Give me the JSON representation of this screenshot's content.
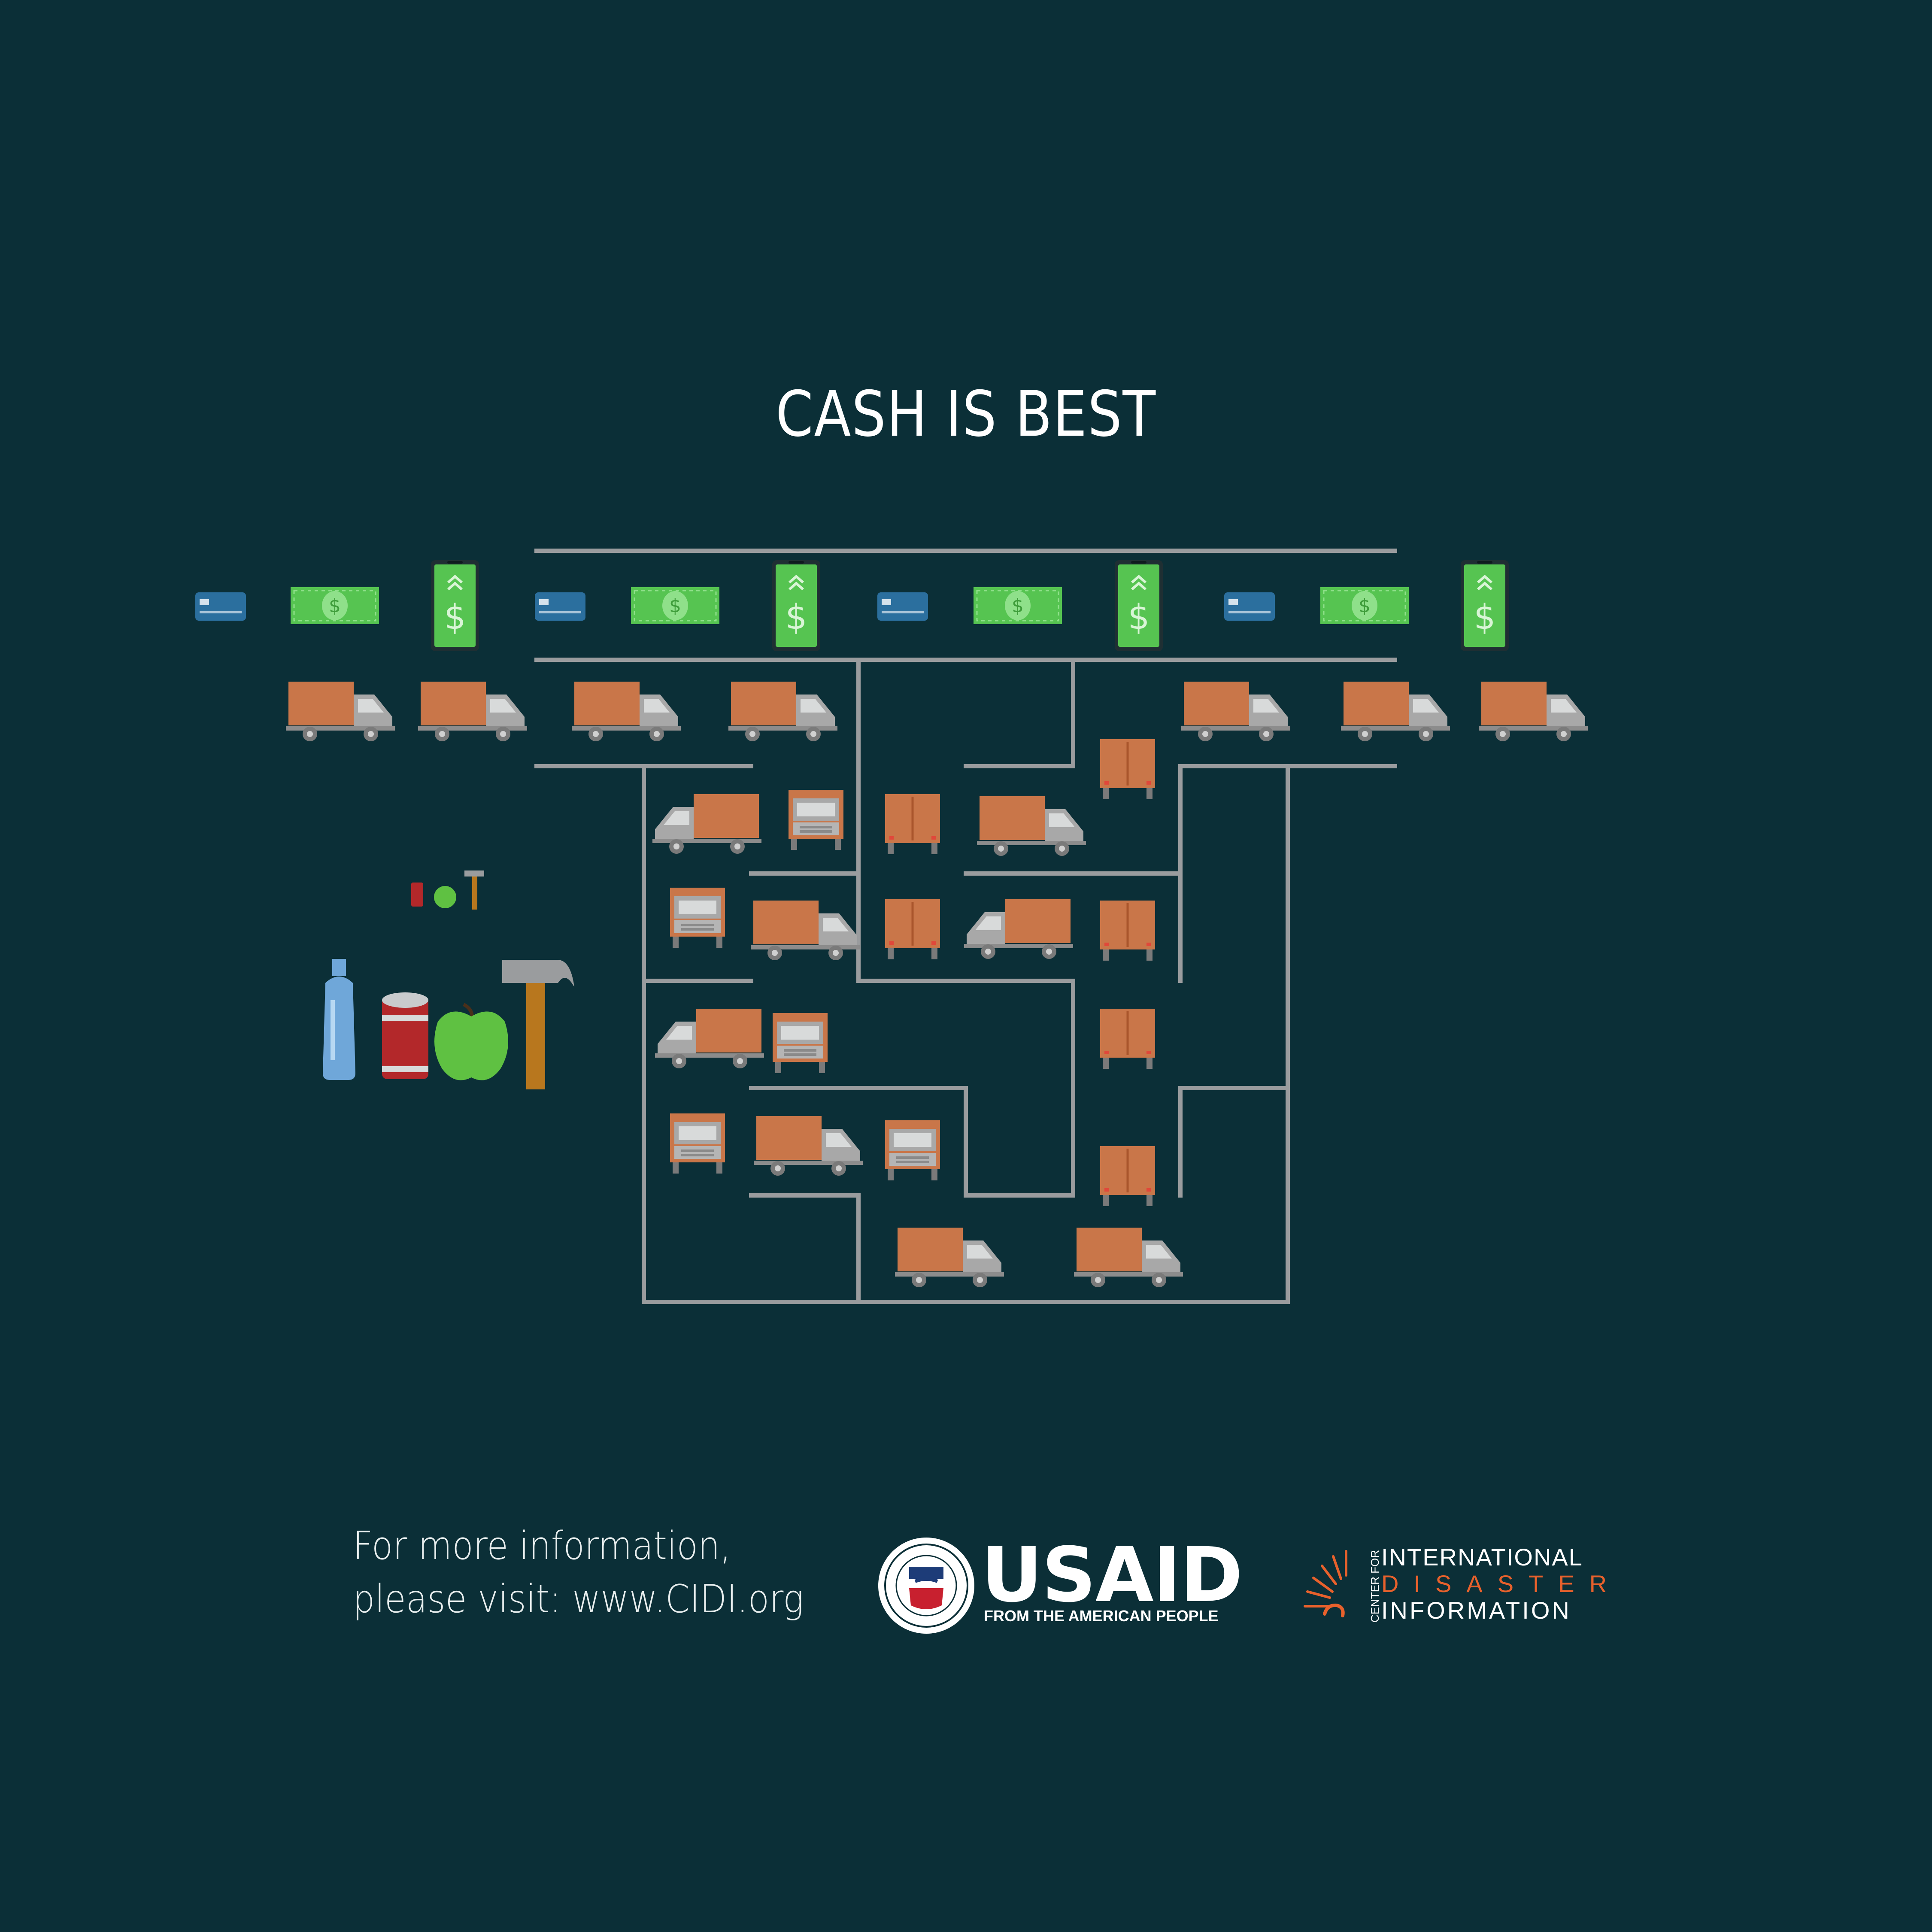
{
  "title": "CASH IS BEST",
  "colors": {
    "background": "#0b2f37",
    "maze_wall": "#9a9c9e",
    "truck_box": "#c97649",
    "truck_cab": "#a8a8a8",
    "cash_green": "#56c451",
    "card_blue": "#2b6f9e",
    "accent_orange": "#e8612c"
  },
  "footer": {
    "info_line1": "For more information,",
    "info_line2": "please visit: www.CIDI.org",
    "usaid_seal_top": "UNITED STATES AGENCY",
    "usaid_seal_bottom": "INTERNATIONAL DEVELOPMENT",
    "usaid_seal_center": "USAID",
    "usaid_word": "USAID",
    "usaid_tagline": "FROM THE AMERICAN PEOPLE",
    "cidi_vertical": "CENTER FOR",
    "cidi_line1": "INTERNATIONAL",
    "cidi_line2": "DISASTER",
    "cidi_line3": "INFORMATION"
  },
  "icons": {
    "row": [
      "credit-card-icon",
      "cash-bill-icon",
      "mobile-money-icon"
    ],
    "truck": "delivery-truck-icon",
    "goods": [
      "water-bottle-icon",
      "tin-can-icon",
      "apple-icon",
      "hammer-icon"
    ]
  }
}
